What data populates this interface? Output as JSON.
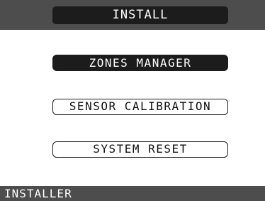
{
  "header": {
    "title": "INSTALL"
  },
  "menu": {
    "items": [
      {
        "label": "ZONES MANAGER",
        "selected": true
      },
      {
        "label": "SENSOR CALIBRATION",
        "selected": false
      },
      {
        "label": "SYSTEM RESET",
        "selected": false
      }
    ]
  },
  "footer": {
    "status": "INSTALLER"
  },
  "colors": {
    "bar_gray": "#4d4d4d",
    "button_dark": "#1c1c1c",
    "background": "#ffffff"
  }
}
